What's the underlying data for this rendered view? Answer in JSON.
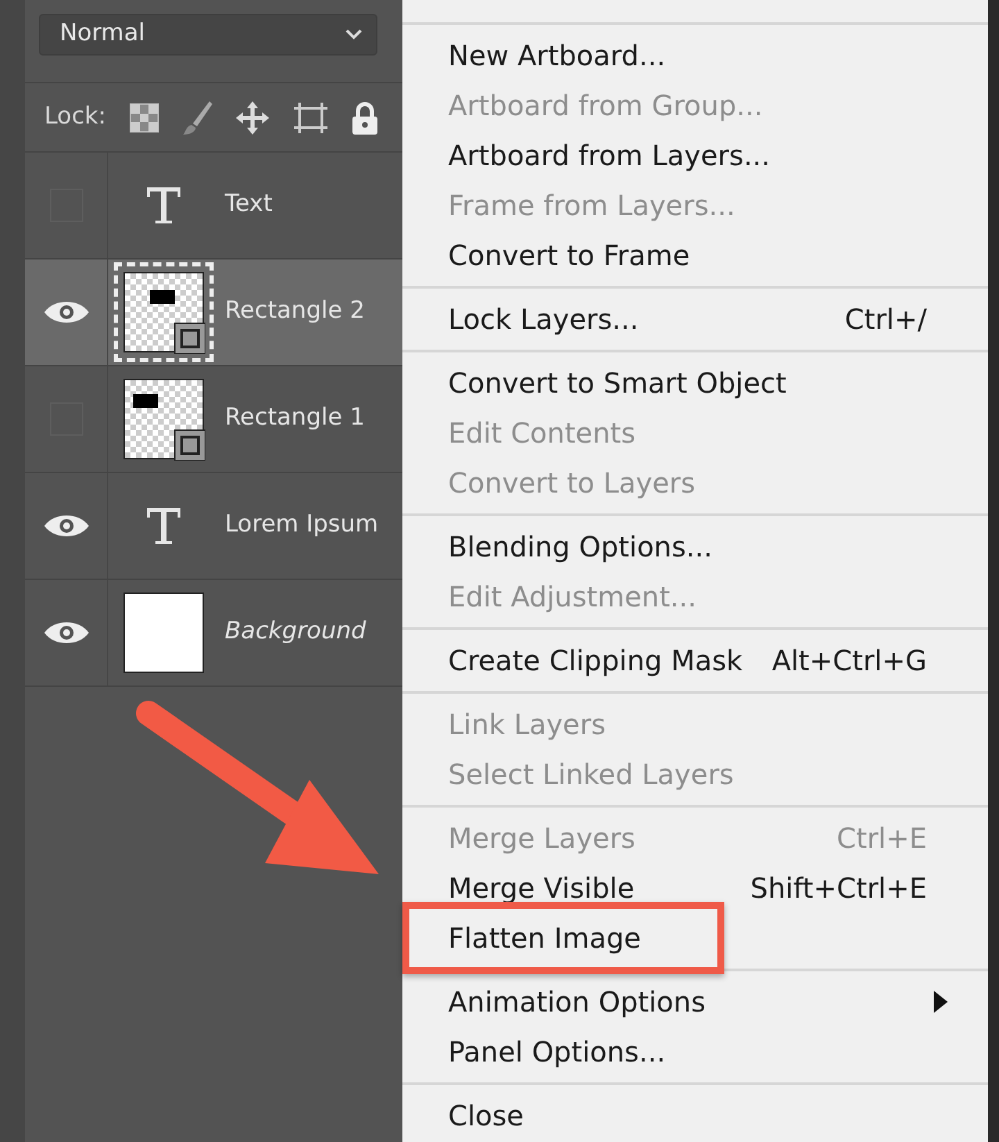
{
  "layers_panel": {
    "blend_mode": "Normal",
    "lock_label": "Lock:",
    "layers": [
      {
        "name": "Text",
        "kind": "text",
        "visible": false,
        "selected": false
      },
      {
        "name": "Rectangle 2",
        "kind": "shape",
        "visible": true,
        "selected": true
      },
      {
        "name": "Rectangle 1",
        "kind": "shape",
        "visible": false,
        "selected": false
      },
      {
        "name": "Lorem Ipsum",
        "kind": "text",
        "visible": true,
        "selected": false
      },
      {
        "name": "Background",
        "kind": "background",
        "visible": true,
        "selected": false
      }
    ]
  },
  "context_menu": {
    "sections": [
      [
        {
          "label": "New Artboard...",
          "disabled": false
        },
        {
          "label": "Artboard from Group...",
          "disabled": true
        },
        {
          "label": "Artboard from Layers...",
          "disabled": false
        },
        {
          "label": "Frame from Layers...",
          "disabled": true
        },
        {
          "label": "Convert to Frame",
          "disabled": false
        }
      ],
      [
        {
          "label": "Lock Layers...",
          "shortcut": "Ctrl+/",
          "disabled": false
        }
      ],
      [
        {
          "label": "Convert to Smart Object",
          "disabled": false
        },
        {
          "label": "Edit Contents",
          "disabled": true
        },
        {
          "label": "Convert to Layers",
          "disabled": true
        }
      ],
      [
        {
          "label": "Blending Options...",
          "disabled": false
        },
        {
          "label": "Edit Adjustment...",
          "disabled": true
        }
      ],
      [
        {
          "label": "Create Clipping Mask",
          "shortcut": "Alt+Ctrl+G",
          "disabled": false
        }
      ],
      [
        {
          "label": "Link Layers",
          "disabled": true
        },
        {
          "label": "Select Linked Layers",
          "disabled": true
        }
      ],
      [
        {
          "label": "Merge Layers",
          "shortcut": "Ctrl+E",
          "disabled": true
        },
        {
          "label": "Merge Visible",
          "shortcut": "Shift+Ctrl+E",
          "disabled": false
        },
        {
          "label": "Flatten Image",
          "disabled": false,
          "highlighted": true
        }
      ],
      [
        {
          "label": "Animation Options",
          "disabled": false,
          "submenu": true
        },
        {
          "label": "Panel Options...",
          "disabled": false
        }
      ],
      [
        {
          "label": "Close",
          "disabled": false
        }
      ]
    ]
  }
}
